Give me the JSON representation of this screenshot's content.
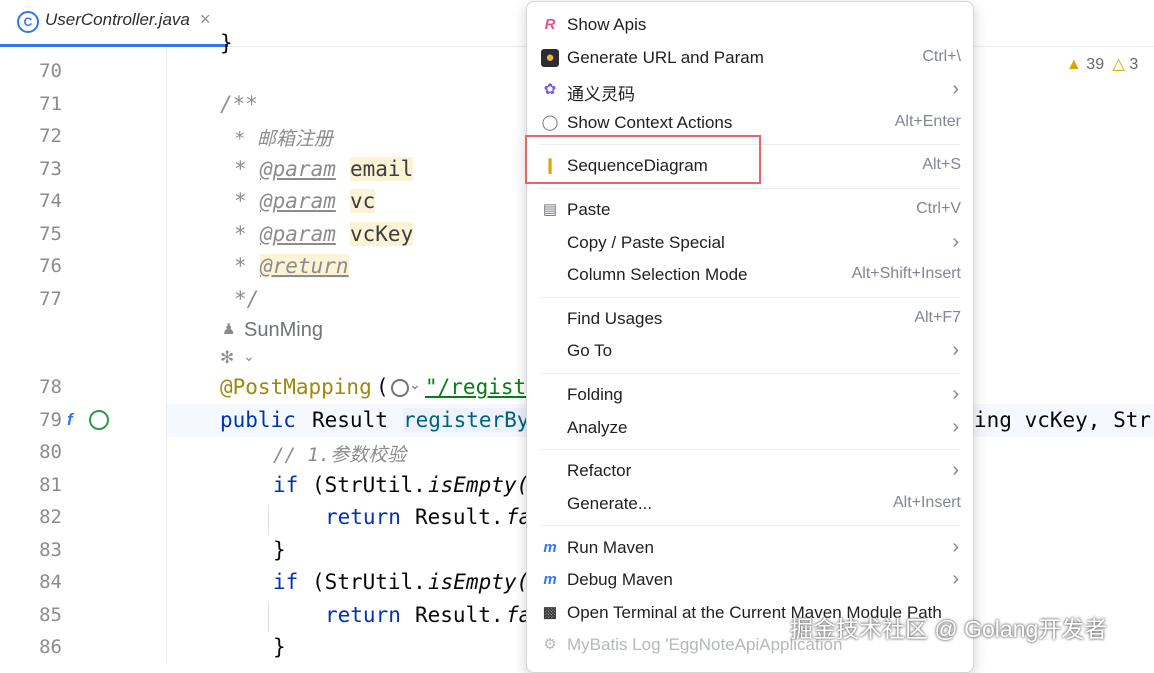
{
  "tab": {
    "title": "UserController.java",
    "close": "×",
    "icon": "C"
  },
  "inspections": {
    "warnings": "39",
    "weak_warnings": "3"
  },
  "code": {
    "line_numbers": [
      "70",
      "71",
      "72",
      "73",
      "74",
      "75",
      "76",
      "77",
      "78",
      "79",
      "80",
      "81",
      "82",
      "83",
      "84",
      "85",
      "86"
    ],
    "closing_brace_partial": "}",
    "jdoc_open": "/**",
    "jdoc_line1": "* 邮箱注册",
    "jdoc_star": "*",
    "param_tag": "@param",
    "param_email": "email",
    "param_vc": "vc",
    "param_vckey": "vcKey",
    "return_tag": "@return",
    "jdoc_close": "*/",
    "author": "SunMing",
    "annotation": "@PostMapping",
    "paren_open": "(",
    "mapping_path": "\"/regist",
    "line79_public": "public",
    "line79_result": "Result",
    "line79_method": "registerBy",
    "line79_tail": "ing vcKey, Str",
    "comment80": "// 1.参数校验",
    "line81_if": "if",
    "line81_rest": "(StrUtil.",
    "line81_method": "isEmpty(",
    "return_kw": "return",
    "result_call": "Result.",
    "fa": "fa",
    "brace": "}"
  },
  "menu": {
    "items": [
      {
        "label": "Show Apis",
        "shortcut": "",
        "icon": "restful-api-icon"
      },
      {
        "label": "Generate URL and Param",
        "shortcut": "Ctrl+\\",
        "icon": "generate-url-icon"
      },
      {
        "label": "通义灵码",
        "shortcut": "",
        "icon": "tongyi-icon"
      },
      {
        "label": "Show Context Actions",
        "shortcut": "Alt+Enter",
        "icon": "lightbulb-icon"
      },
      {
        "label": "SequenceDiagram",
        "shortcut": "Alt+S",
        "icon": "sequence-diagram-icon"
      },
      {
        "label": "Paste",
        "shortcut": "Ctrl+V",
        "icon": "clipboard-icon"
      },
      {
        "label": "Copy / Paste Special",
        "shortcut": ""
      },
      {
        "label": "Column Selection Mode",
        "shortcut": "Alt+Shift+Insert"
      },
      {
        "label": "Find Usages",
        "shortcut": "Alt+F7"
      },
      {
        "label": "Go To",
        "shortcut": ""
      },
      {
        "label": "Folding",
        "shortcut": ""
      },
      {
        "label": "Analyze",
        "shortcut": ""
      },
      {
        "label": "Refactor",
        "shortcut": ""
      },
      {
        "label": "Generate...",
        "shortcut": "Alt+Insert"
      },
      {
        "label": "Run Maven",
        "shortcut": "",
        "icon": "maven-run-icon"
      },
      {
        "label": "Debug Maven",
        "shortcut": "",
        "icon": "maven-debug-icon"
      },
      {
        "label": "Open Terminal at the Current Maven Module Path",
        "shortcut": "",
        "icon": "terminal-icon"
      },
      {
        "label": "MyBatis Log 'EggNoteApiApplication",
        "shortcut": "",
        "icon": "mybatis-icon"
      }
    ]
  },
  "watermark": "掘金技术社区 @ Golang开发者",
  "colors": {
    "accent": "#3574f0",
    "highlight_box": "#e8636b",
    "annotation": "#9e880d",
    "keyword": "#0033b3",
    "string": "#067d17"
  }
}
